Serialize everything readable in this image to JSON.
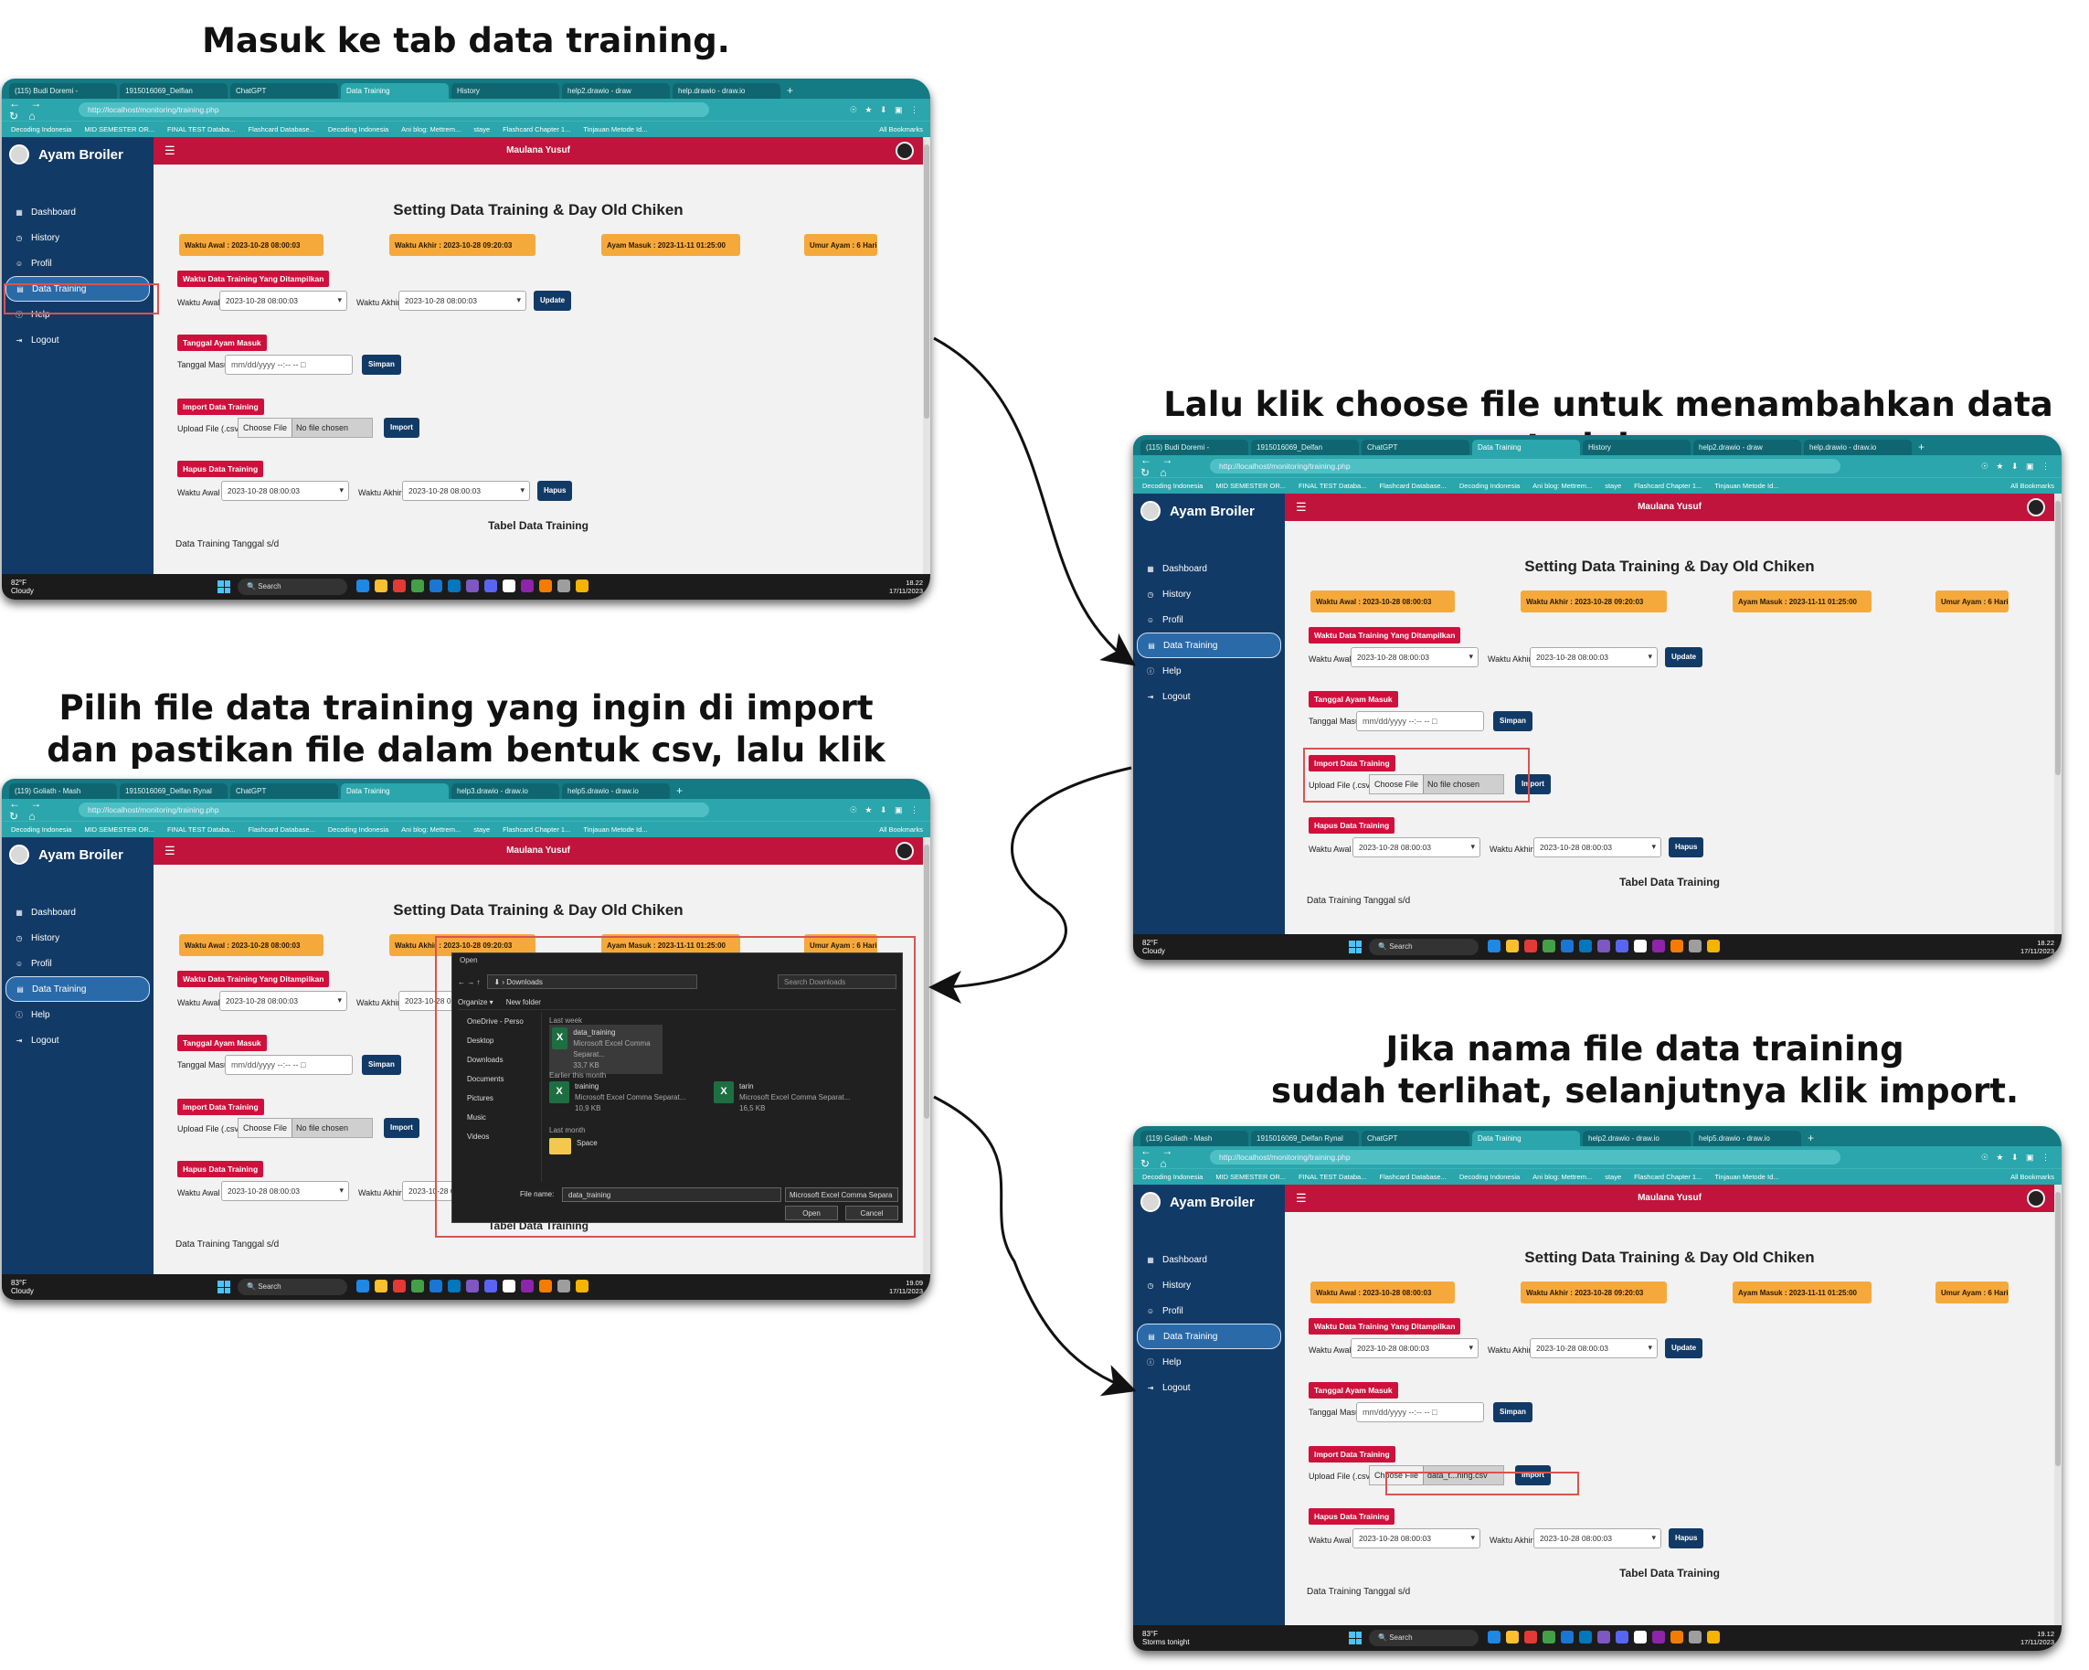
{
  "captions": {
    "step1": "Masuk ke tab data training.",
    "step2": "Lalu klik choose file untuk menambahkan data training.",
    "step3_line1": "Pilih file data training yang ingin di import",
    "step3_line2": "dan pastikan file dalam bentuk csv, lalu klik open.",
    "step4_line1": "Jika nama file data training",
    "step4_line2": "sudah terlihat, selanjutnya klik import."
  },
  "browser": {
    "url": "http://localhost/monitoring/training.php",
    "nav_icons": "← → ↻ ⌂",
    "ext_icons": "☉ ★ ⬇ ▣ ⋮",
    "tab_sets": {
      "s1": [
        "(115) Budi Doremi -",
        "1915016069_Delfian",
        "ChatGPT",
        "Data Training",
        "History",
        "help2.drawio - draw",
        "help.drawio - draw.io",
        "+"
      ],
      "s2": [
        "(115) Budi Doremi -",
        "1915016069_Delfan",
        "ChatGPT",
        "Data Training",
        "History",
        "help2.drawio - draw",
        "help.drawio - draw.io",
        "+"
      ],
      "s3": [
        "(119) Goliath - Mash",
        "1915016069_Delfan Rynal",
        "ChatGPT",
        "Data Training",
        "help3.drawio - draw.io",
        "help5.drawio - draw.io",
        "+"
      ],
      "s4": [
        "(119) Goliath - Mash",
        "1915016069_Delfan Rynal",
        "ChatGPT",
        "Data Training",
        "help2.drawio - draw.io",
        "help5.drawio - draw.io",
        "+"
      ]
    },
    "bookmarks": [
      "Decoding Indonesia",
      "MID SEMESTER OR...",
      "FINAL TEST Databa...",
      "Flashcard Database...",
      "Decoding Indonesia",
      "Ani blog: Mettrem...",
      "staye",
      "Flashcard Chapter 1...",
      "Tinjauan Metode Id..."
    ],
    "all_bookmarks": "All Bookmarks",
    "active_tab_index": 3
  },
  "app": {
    "brand": "Ayam Broiler",
    "user": "Maulana Yusuf",
    "menu": [
      "Dashboard",
      "History",
      "Profil",
      "Data Training",
      "Help",
      "Logout"
    ],
    "menu_icons": [
      "▦",
      "◷",
      "☺",
      "▤",
      "ⓘ",
      "⇥"
    ],
    "active_menu_index": 3,
    "page_title": "Setting Data Training & Day Old Chiken",
    "cards": [
      "Waktu Awal : 2023-10-28 08:00:03",
      "Waktu Akhir : 2023-10-28 09:20:03",
      "Ayam Masuk : 2023-11-11 01:25:00",
      "Umur Ayam : 6 Hari"
    ],
    "sections": [
      "Waktu Data Training Yang Ditampilkan",
      "Tanggal Ayam Masuk",
      "Import Data Training",
      "Hapus Data Training"
    ],
    "label_waktu_awal": "Waktu Awal",
    "label_waktu_akhir": "Waktu Akhir",
    "value_awal": "2023-10-28 08:00:03",
    "value_akhir": "2023-10-28 08:00:03",
    "update_button": "Update",
    "label_tanggal": "Tanggal Masuk",
    "date_placeholder": "mm/dd/yyyy --:-- --  □",
    "simpan_button": "Simpan",
    "label_upload": "Upload File (.csv)",
    "choose_button": "Choose File",
    "no_file": "No file chosen",
    "chosen_file": "data_t...ning.csv",
    "import_button": "Import",
    "hapus_button": "Hapus",
    "table_title": "Tabel Data Training",
    "table_sub": "Data Training Tanggal s/d"
  },
  "taskbar": {
    "search": "Search",
    "weather_s1": "82°F\nCloudy",
    "weather_s2": "82°F\nCloudy",
    "weather_s3": "83°F\nCloudy",
    "weather_s4": "83°F\nStorms tonight",
    "clock_s1": "18.22\n17/11/2023",
    "clock_s2": "18.22\n17/11/2023",
    "clock_s3": "19.09\n17/11/2023",
    "clock_s4": "19.12\n17/11/2023"
  },
  "open_dialog": {
    "title": "Open",
    "path": "⬇  ›  Downloads",
    "search_placeholder": "Search Downloads",
    "organize": "Organize ▾",
    "new_folder": "New folder",
    "tree": [
      "OneDrive - Perso",
      "Desktop",
      "Downloads",
      "Documents",
      "Pictures",
      "Music",
      "Videos"
    ],
    "groups": [
      "Last week",
      "Earlier this month",
      "Last month"
    ],
    "file1_name": "data_training",
    "file1_type": "Microsoft Excel Comma Separat...",
    "file1_size": "33,7 KB",
    "file2_name": "training",
    "file2_type": "Microsoft Excel Comma Separat...",
    "file2_size": "10,9 KB",
    "file3_name": "tarin",
    "file3_type": "Microsoft Excel Comma Separat...",
    "file3_size": "16,5 KB",
    "folder_name": "Space",
    "file_name_label": "File name:",
    "file_name_value": "data_training",
    "file_type_value": "Microsoft Excel Comma Separa",
    "open_button": "Open",
    "cancel_button": "Cancel"
  },
  "colors": {
    "primary": "#123a66",
    "accent_red": "#c0143c",
    "card_orange": "#f6a93b",
    "browser_teal": "#2aa6ac",
    "highlight": "#d9534f"
  }
}
